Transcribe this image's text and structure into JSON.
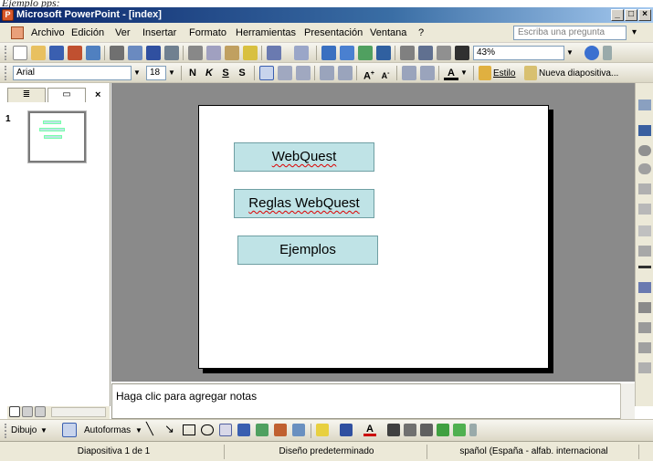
{
  "caption": "Ejemplo pps:",
  "window": {
    "title": "Microsoft PowerPoint - [index]",
    "controls": [
      "_",
      "□",
      "×"
    ]
  },
  "menu": {
    "items": [
      "Archivo",
      "Edición",
      "Ver",
      "Insertar",
      "Formato",
      "Herramientas",
      "Presentación",
      "Ventana",
      "?"
    ],
    "ask_placeholder": "Escriba una pregunta"
  },
  "standard_toolbar": {
    "zoom": "43%"
  },
  "format_toolbar": {
    "font": "Arial",
    "size": "18",
    "bold": "N",
    "italic": "K",
    "underline": "S",
    "shadow": "S",
    "style_label": "Estilo",
    "new_slide_label": "Nueva diapositiva..."
  },
  "left_pane": {
    "tabs": [
      "≣",
      "▭"
    ],
    "close": "×",
    "slide_number": "1"
  },
  "slide": {
    "buttons": [
      "WebQuest",
      "Reglas WebQuest",
      "Ejemplos"
    ]
  },
  "notes": {
    "placeholder": "Haga clic para agregar notas"
  },
  "drawing_toolbar": {
    "draw_label": "Dibujo",
    "autoshapes_label": "Autoformas"
  },
  "status": {
    "slide_info": "Diapositiva 1 de 1",
    "design": "Diseño predeterminado",
    "language": "spañol (España - alfab. internacional"
  }
}
